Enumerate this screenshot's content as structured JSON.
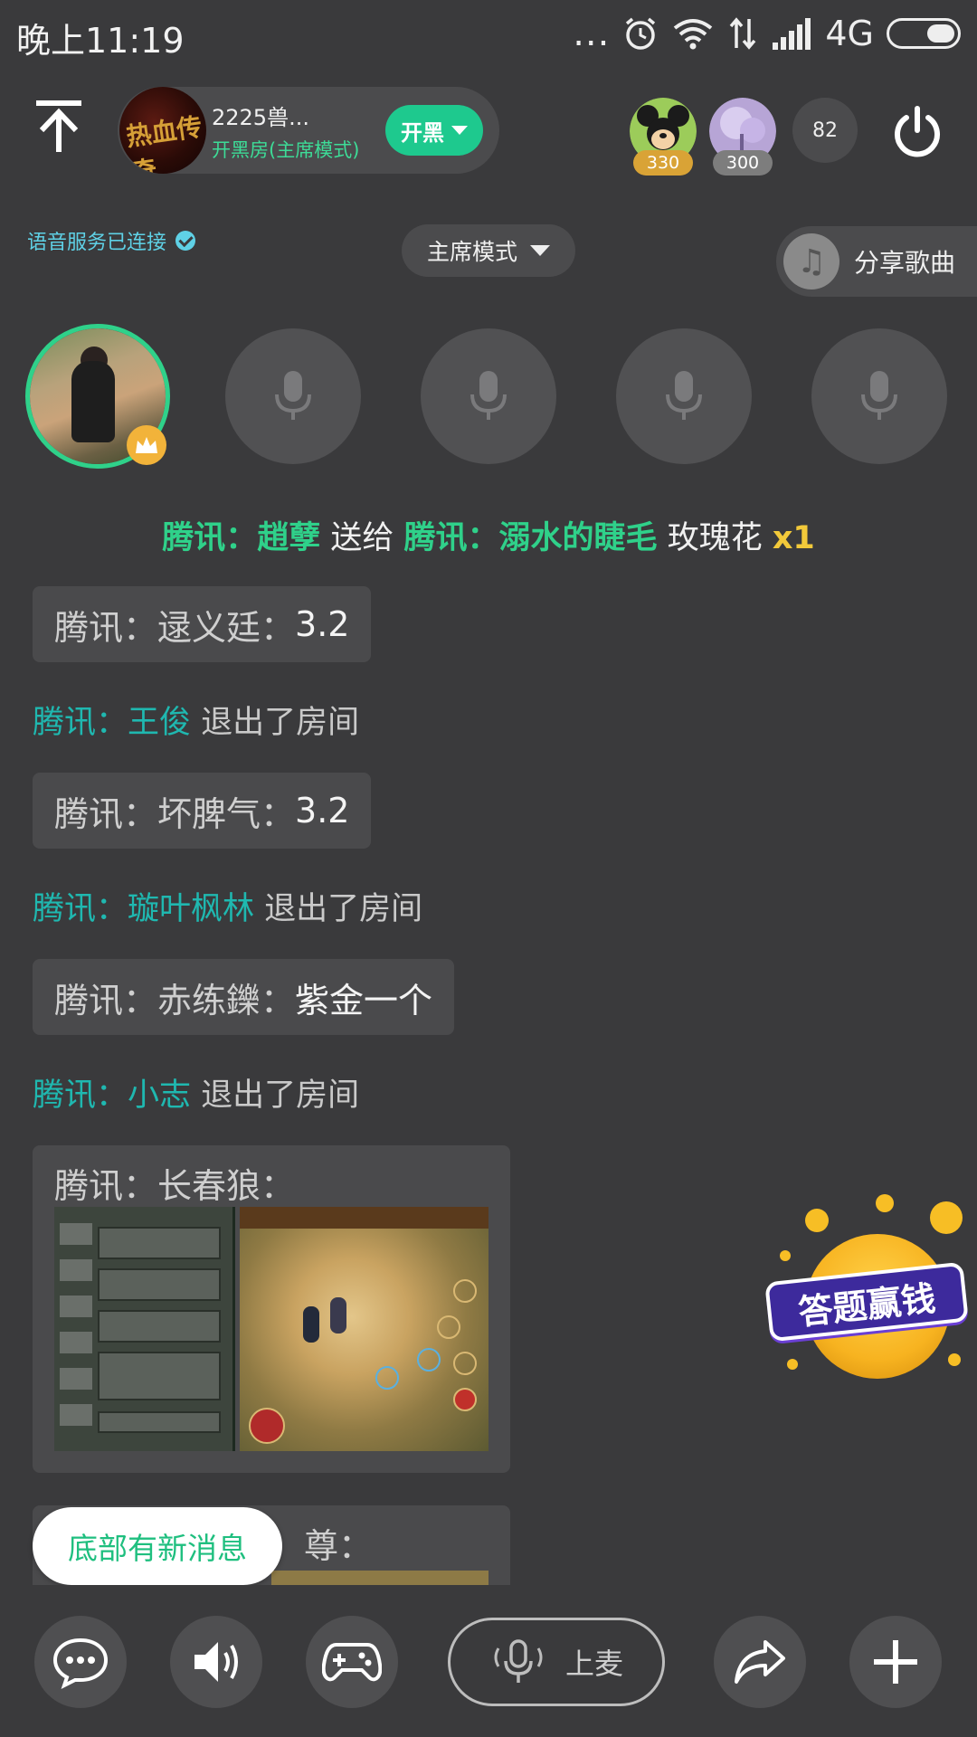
{
  "status_bar": {
    "time": "晚上11:19",
    "dots": "...",
    "network": "4G"
  },
  "room": {
    "name": "2225兽...",
    "mode_label": "开黑房(主席模式)",
    "action_label": "开黑",
    "logo_text": "热血传奇"
  },
  "top_users": [
    {
      "count": "330",
      "badge_color": "#d9a336"
    },
    {
      "count": "300",
      "badge_color": "#7d7d7d"
    }
  ],
  "audience_count": "82",
  "voice_status": "语音服务已连接",
  "mode_dropdown": "主席模式",
  "share_song": "分享歌曲",
  "gift": {
    "sender": "腾讯：趙孽",
    "verb": "送给",
    "receiver": "腾讯：溺水的睫毛",
    "item": "玫瑰花",
    "qty": "x1"
  },
  "messages": [
    {
      "type": "chat",
      "user": "腾讯：逯义廷：",
      "text": "3.2"
    },
    {
      "type": "exit",
      "user": "腾讯：王俊",
      "text": "退出了房间"
    },
    {
      "type": "chat",
      "user": "腾讯：坏脾气：",
      "text": "3.2"
    },
    {
      "type": "exit",
      "user": "腾讯：璇叶枫林",
      "text": "退出了房间"
    },
    {
      "type": "chat",
      "user": "腾讯：赤练鑠：",
      "text": "紫金一个"
    },
    {
      "type": "exit",
      "user": "腾讯：小志",
      "text": "退出了房间"
    },
    {
      "type": "image",
      "user": "腾讯：长春狼："
    },
    {
      "type": "image",
      "user": "尊："
    }
  ],
  "new_message_pill": "底部有新消息",
  "quiz_widget": "答题赢钱",
  "bottom_bar": {
    "mic_label": "上麦"
  },
  "colors": {
    "accent_green": "#2fd18a",
    "teal": "#1fb8b0",
    "gold": "#f2c93a",
    "background": "#3a3a3c"
  }
}
